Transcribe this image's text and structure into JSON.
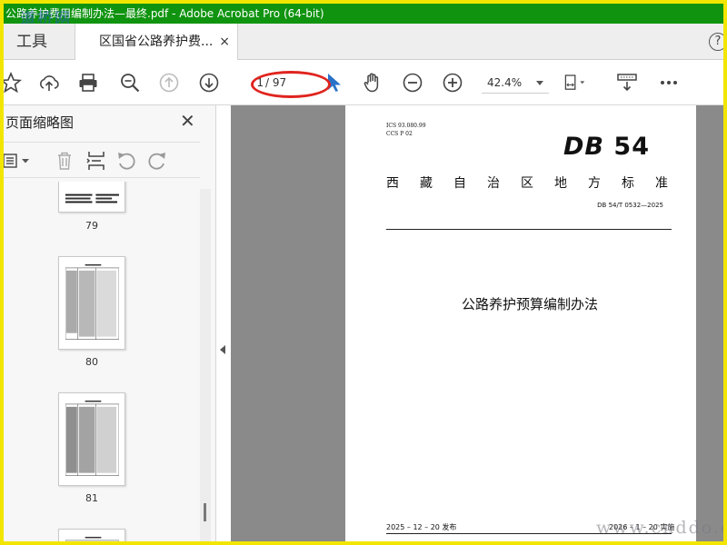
{
  "window": {
    "title": "公路养护费用编制办法—最终.pdf - Adobe Acrobat Pro (64-bit)",
    "watermark_top": "道桥网"
  },
  "tabs": {
    "tools_label": "工具",
    "document_label": "区国省公路养护费...",
    "close_glyph": "×",
    "help_glyph": "?"
  },
  "toolbar": {
    "current_page": "1",
    "total_pages": "/ 97",
    "zoom": "42.4%",
    "icons": [
      "bookmark-star-icon",
      "cloud-upload-icon",
      "print-icon",
      "zoom-search-icon",
      "page-up-icon",
      "page-down-icon",
      "select-cursor-icon",
      "hand-icon",
      "zoom-out-icon",
      "zoom-in-icon",
      "fit-page-icon",
      "keyboard-scroll-icon",
      "more-icon"
    ]
  },
  "sidebar": {
    "title": "页面缩略图",
    "close_glyph": "✕",
    "thumbnails": [
      {
        "label": "79"
      },
      {
        "label": "80"
      },
      {
        "label": "81"
      },
      {
        "label": ""
      }
    ]
  },
  "document": {
    "ics": "ICS  93.080.99",
    "ccs": "CCS  P  02",
    "logo_db": "DB",
    "logo_num": "54",
    "standard_title_chars": [
      "西",
      "藏",
      "自",
      "治",
      "区",
      "地",
      "方",
      "标",
      "准"
    ],
    "standard_no": "DB 54/T  0532—2025",
    "main_title": "公路养护预算编制办法",
    "publish_date": "2025 – 12 – 20 发布",
    "implement_date": "2026 – 1 – 20 实施"
  },
  "watermark_bottom": "www.cnddo.c",
  "colors": {
    "titlebar": "#109410",
    "outer_border": "#f2e600",
    "annotation_ellipse": "#e0241e",
    "doc_background": "#8a8a8a"
  }
}
